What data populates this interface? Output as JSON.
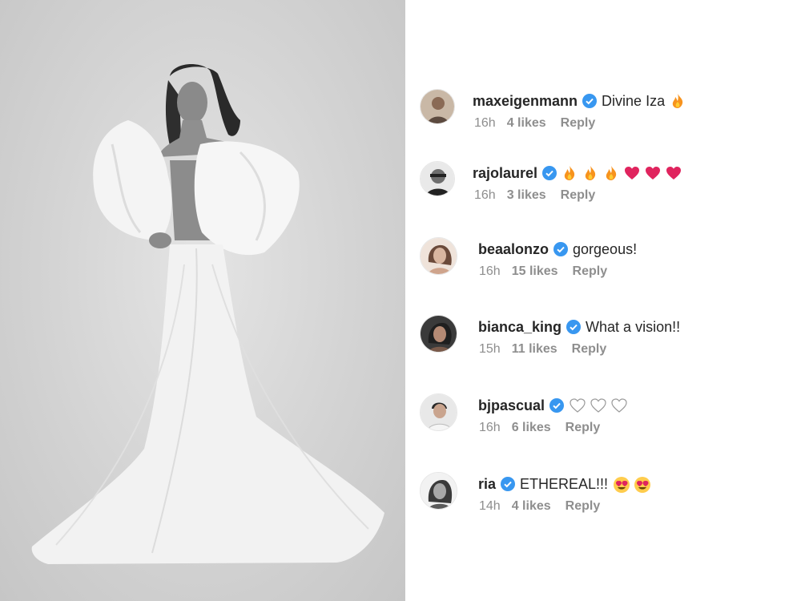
{
  "photo": {
    "alt_subject": "woman-in-white-gown"
  },
  "colors": {
    "verified": "#3897f0",
    "meta": "#8e8e8e",
    "text": "#262626"
  },
  "comments": [
    {
      "username": "maxeigenmann",
      "text": "Divine Iza",
      "emojis": [
        "fire"
      ],
      "time": "16h",
      "likes": "4 likes",
      "reply": "Reply"
    },
    {
      "username": "rajolaurel",
      "text": "",
      "emojis": [
        "fire",
        "fire",
        "fire",
        "red-heart",
        "red-heart",
        "red-heart"
      ],
      "time": "16h",
      "likes": "3 likes",
      "reply": "Reply"
    },
    {
      "username": "beaalonzo",
      "text": "gorgeous!",
      "emojis": [],
      "time": "16h",
      "likes": "15 likes",
      "reply": "Reply"
    },
    {
      "username": "bianca_king",
      "text": "What a vision!!",
      "emojis": [],
      "time": "15h",
      "likes": "11 likes",
      "reply": "Reply"
    },
    {
      "username": "bjpascual",
      "text": "",
      "emojis": [
        "white-heart",
        "white-heart",
        "white-heart"
      ],
      "time": "16h",
      "likes": "6 likes",
      "reply": "Reply"
    },
    {
      "username": "ria",
      "text": "ETHEREAL!!!",
      "emojis": [
        "heart-eyes",
        "heart-eyes"
      ],
      "time": "14h",
      "likes": "4 likes",
      "reply": "Reply"
    }
  ]
}
